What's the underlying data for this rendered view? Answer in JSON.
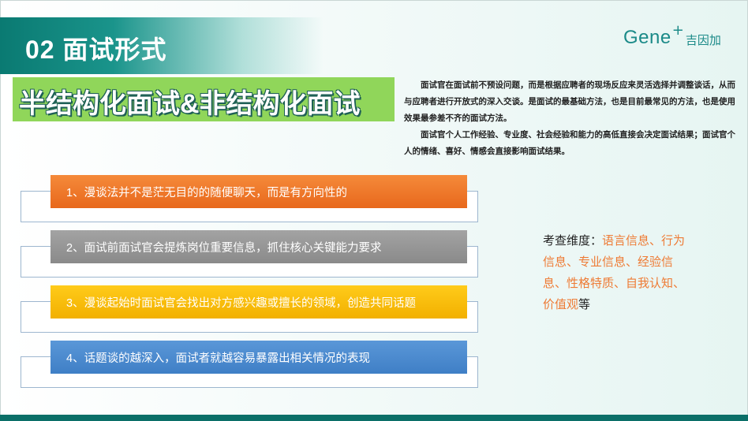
{
  "header": {
    "title": "02 面试形式"
  },
  "logo": {
    "text": "Gene",
    "plus": "+",
    "cn": "吉因加"
  },
  "subtitle": "半结构化面试&非结构化面试",
  "description": {
    "p1": "面试官在面试前不预设问题，而是根据应聘者的现场反应来灵活选择并调整谈话，从而与应聘者进行开放式的深入交谈。是面试的最基础方法，也是目前最常见的方法，也是使用效果最参差不齐的面试方法。",
    "p2": "面试官个人工作经验、专业度、社会经验和能力的高低直接会决定面试结果；面试官个人的情绪、喜好、情感会直接影响面试结果。"
  },
  "items": [
    {
      "label": "1、漫谈法并不是茫无目的的随便聊天，而是有方向性的"
    },
    {
      "label": "2、面试前面试官会提炼岗位重要信息，抓住核心关键能力要求"
    },
    {
      "label": "3、漫谈起始时面试官会找出对方感兴趣或擅长的领域，创造共同话题"
    },
    {
      "label": "4、话题谈的越深入，面试者就越容易暴露出相关情况的表现"
    }
  ],
  "dimensions": {
    "prefix": "考查维度：",
    "content": "语言信息、行为信息、专业信息、经验信息、性格特质、自我认知、价值观",
    "suffix": "等"
  },
  "colors": {
    "accent": "#ee7b35",
    "teal": "#0a7a72",
    "green": "#90d65a"
  }
}
